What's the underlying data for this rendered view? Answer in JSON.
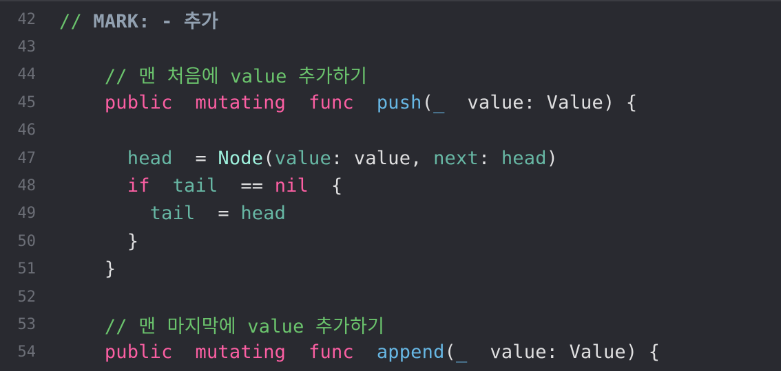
{
  "editor": {
    "lines": [
      {
        "number": "42",
        "tokens": [
          {
            "t": "// ",
            "c": "comment"
          },
          {
            "t": "MARK: - 추가",
            "c": "mark"
          }
        ]
      },
      {
        "number": "43",
        "tokens": []
      },
      {
        "number": "44",
        "tokens": [
          {
            "t": "  // 맨 처음에 value 추가하기",
            "c": "comment"
          }
        ]
      },
      {
        "number": "45",
        "tokens": [
          {
            "t": "  ",
            "c": "plain"
          },
          {
            "t": "public",
            "c": "keyword"
          },
          {
            "t": " ",
            "c": "plain"
          },
          {
            "t": "mutating",
            "c": "keyword"
          },
          {
            "t": " ",
            "c": "plain"
          },
          {
            "t": "func",
            "c": "keyword"
          },
          {
            "t": " ",
            "c": "plain"
          },
          {
            "t": "push",
            "c": "func"
          },
          {
            "t": "(",
            "c": "plain"
          },
          {
            "t": "_",
            "c": "func"
          },
          {
            "t": " value: Value) {",
            "c": "plain"
          }
        ]
      },
      {
        "number": "46",
        "tokens": []
      },
      {
        "number": "47",
        "tokens": [
          {
            "t": "   ",
            "c": "plain"
          },
          {
            "t": "head",
            "c": "prop"
          },
          {
            "t": " = ",
            "c": "plain"
          },
          {
            "t": "Node",
            "c": "class"
          },
          {
            "t": "(",
            "c": "plain"
          },
          {
            "t": "value",
            "c": "prop"
          },
          {
            "t": ": value, ",
            "c": "plain"
          },
          {
            "t": "next",
            "c": "prop"
          },
          {
            "t": ": ",
            "c": "plain"
          },
          {
            "t": "head",
            "c": "prop"
          },
          {
            "t": ")",
            "c": "plain"
          }
        ]
      },
      {
        "number": "48",
        "tokens": [
          {
            "t": "   ",
            "c": "plain"
          },
          {
            "t": "if",
            "c": "keyword"
          },
          {
            "t": " ",
            "c": "plain"
          },
          {
            "t": "tail",
            "c": "prop"
          },
          {
            "t": " == ",
            "c": "plain"
          },
          {
            "t": "nil",
            "c": "keyword"
          },
          {
            "t": " {",
            "c": "plain"
          }
        ]
      },
      {
        "number": "49",
        "tokens": [
          {
            "t": "    ",
            "c": "plain"
          },
          {
            "t": "tail",
            "c": "prop"
          },
          {
            "t": " = ",
            "c": "plain"
          },
          {
            "t": "head",
            "c": "prop"
          }
        ]
      },
      {
        "number": "50",
        "tokens": [
          {
            "t": "   }",
            "c": "plain"
          }
        ]
      },
      {
        "number": "51",
        "tokens": [
          {
            "t": "  }",
            "c": "plain"
          }
        ]
      },
      {
        "number": "52",
        "tokens": []
      },
      {
        "number": "53",
        "tokens": [
          {
            "t": "  // 맨 마지막에 value 추가하기",
            "c": "comment"
          }
        ]
      },
      {
        "number": "54",
        "tokens": [
          {
            "t": "  ",
            "c": "plain"
          },
          {
            "t": "public",
            "c": "keyword"
          },
          {
            "t": " ",
            "c": "plain"
          },
          {
            "t": "mutating",
            "c": "keyword"
          },
          {
            "t": " ",
            "c": "plain"
          },
          {
            "t": "func",
            "c": "keyword"
          },
          {
            "t": " ",
            "c": "plain"
          },
          {
            "t": "append",
            "c": "func"
          },
          {
            "t": "(",
            "c": "plain"
          },
          {
            "t": "_",
            "c": "func"
          },
          {
            "t": " value: Value) {",
            "c": "plain"
          }
        ]
      }
    ]
  },
  "colors": {
    "background": "#292a30",
    "line_number": "#6c6f77",
    "plain": "#dfdfe0",
    "comment": "#6bc46d",
    "keyword": "#fc5fa3",
    "function": "#67b7e4",
    "class": "#9ef1dd",
    "property": "#67b7a4"
  }
}
